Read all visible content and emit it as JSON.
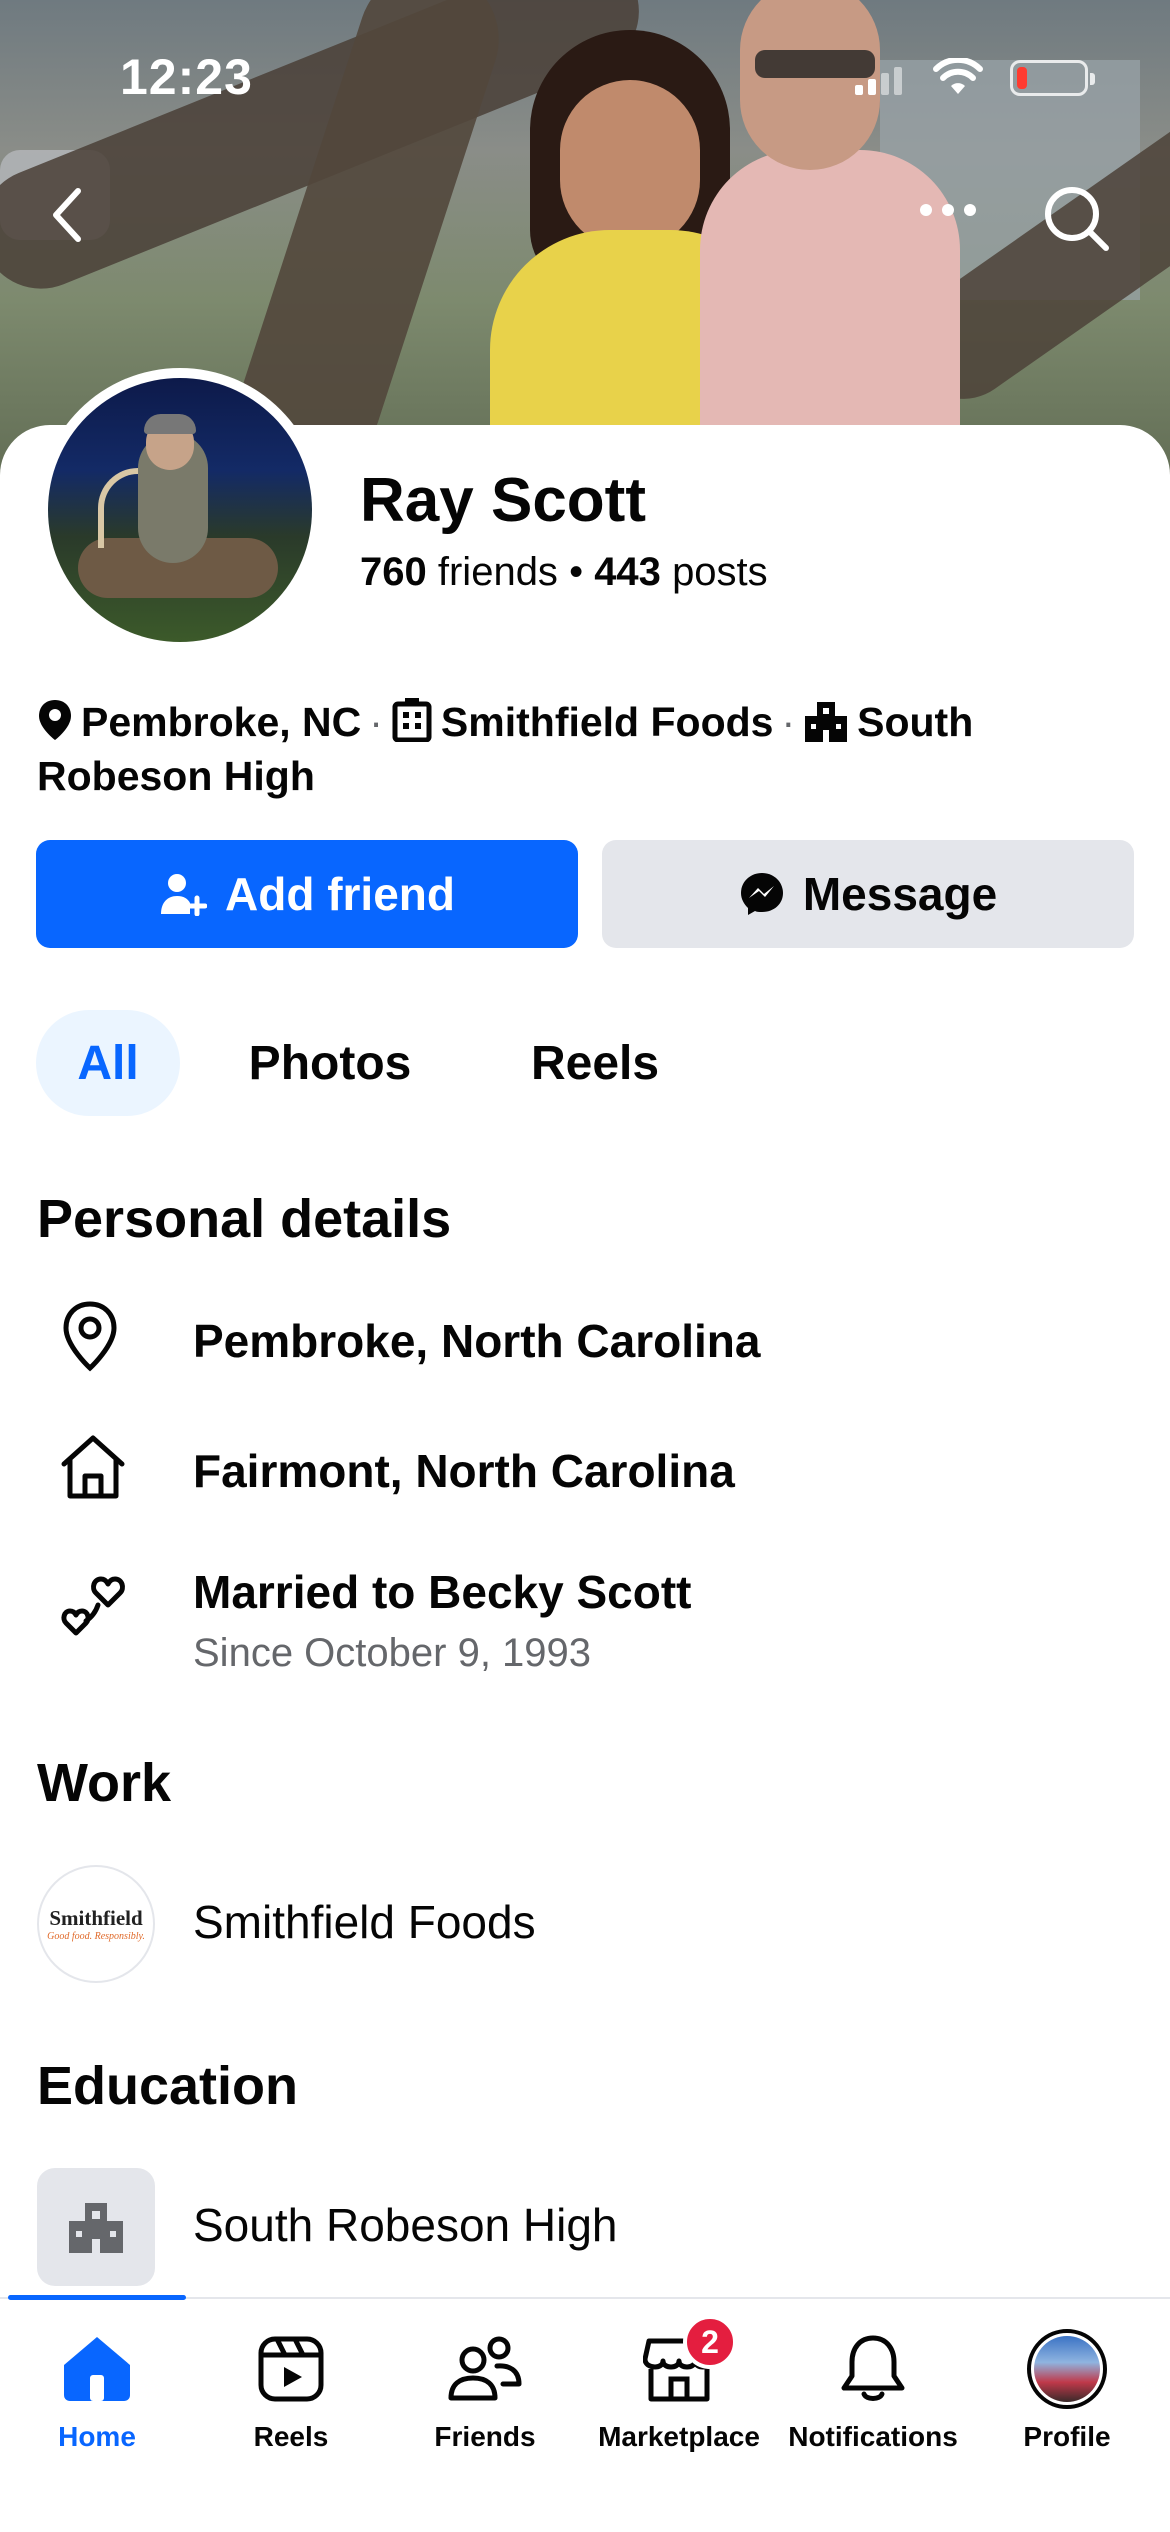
{
  "status_bar": {
    "time": "12:23"
  },
  "profile": {
    "name": "Ray Scott",
    "friends_count": "760",
    "friends_label": "friends",
    "posts_count": "443",
    "posts_label": "posts",
    "intro": {
      "location": "Pembroke, NC",
      "work": "Smithfield Foods",
      "school": "South Robeson High"
    }
  },
  "actions": {
    "add_friend": "Add friend",
    "message": "Message"
  },
  "tabs": [
    {
      "label": "All",
      "active": true
    },
    {
      "label": "Photos",
      "active": false
    },
    {
      "label": "Reels",
      "active": false
    }
  ],
  "personal_details": {
    "title": "Personal details",
    "current_city": "Pembroke, North Carolina",
    "hometown": "Fairmont, North Carolina",
    "relationship": "Married to Becky Scott",
    "relationship_since": "Since October 9, 1993"
  },
  "work": {
    "title": "Work",
    "employer": "Smithfield Foods",
    "logo_text": "Smithfield",
    "logo_tagline": "Good food. Responsibly."
  },
  "education": {
    "title": "Education",
    "school": "South Robeson High"
  },
  "bottom_nav": {
    "items": [
      {
        "label": "Home",
        "icon": "home-icon",
        "active": true
      },
      {
        "label": "Reels",
        "icon": "reels-icon",
        "active": false
      },
      {
        "label": "Friends",
        "icon": "friends-icon",
        "active": false
      },
      {
        "label": "Marketplace",
        "icon": "marketplace-icon",
        "active": false,
        "badge": "2"
      },
      {
        "label": "Notifications",
        "icon": "bell-icon",
        "active": false
      },
      {
        "label": "Profile",
        "icon": "avatar",
        "active": false
      }
    ]
  },
  "colors": {
    "accent": "#0866ff",
    "secondary_button": "#e4e6eb",
    "active_tab_bg": "#ebf5ff",
    "badge": "#e41e3f",
    "muted_text": "#65676b"
  }
}
